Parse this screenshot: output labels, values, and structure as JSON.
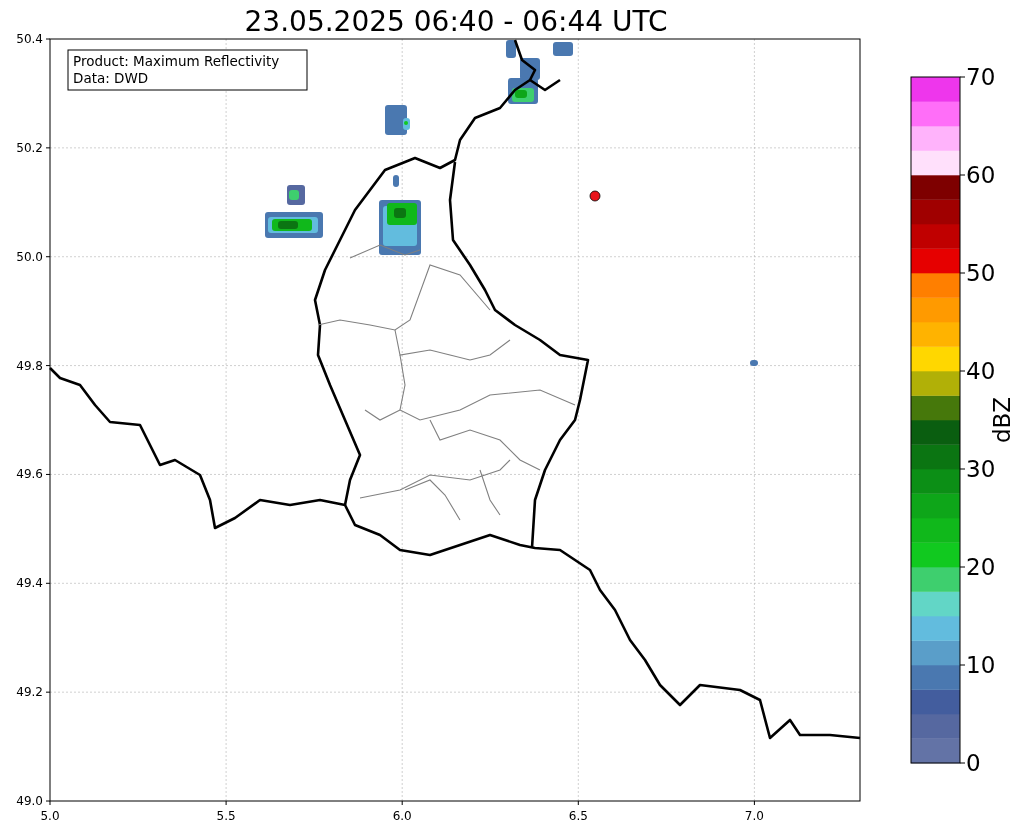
{
  "title": "23.05.2025 06:40 - 06:44 UTC",
  "annotation": [
    "Product: Maximum Reflectivity",
    "Data: DWD"
  ],
  "map": {
    "x_ticks": [
      "5.0",
      "5.5",
      "6.0",
      "6.5",
      "7.0"
    ],
    "y_ticks": [
      "50.4",
      "50.2",
      "50.0",
      "49.8",
      "49.6",
      "49.4",
      "49.2",
      "49.0"
    ]
  },
  "colorbar": {
    "label": "dBZ",
    "ticks": [
      "70",
      "60",
      "50",
      "40",
      "30",
      "20",
      "10",
      "0"
    ],
    "segments": [
      {
        "color": "#6373a6"
      },
      {
        "color": "#5668a0"
      },
      {
        "color": "#435d9e"
      },
      {
        "color": "#4a78b0"
      },
      {
        "color": "#5a9ec9"
      },
      {
        "color": "#62bcde"
      },
      {
        "color": "#62d6c6"
      },
      {
        "color": "#3ecf6e"
      },
      {
        "color": "#11c91f"
      },
      {
        "color": "#10b81b"
      },
      {
        "color": "#0ea619"
      },
      {
        "color": "#0c8f16"
      },
      {
        "color": "#0b7512"
      },
      {
        "color": "#0a5e10"
      },
      {
        "color": "#46780b"
      },
      {
        "color": "#b1b007"
      },
      {
        "color": "#ffd700"
      },
      {
        "color": "#ffb300"
      },
      {
        "color": "#ff9a00"
      },
      {
        "color": "#ff7f00"
      },
      {
        "color": "#e60000"
      },
      {
        "color": "#c00000"
      },
      {
        "color": "#a00000"
      },
      {
        "color": "#7e0000"
      },
      {
        "color": "#ffe0fb"
      },
      {
        "color": "#ffb3fb"
      },
      {
        "color": "#ff6ef8"
      },
      {
        "color": "#ee36ec"
      }
    ]
  }
}
